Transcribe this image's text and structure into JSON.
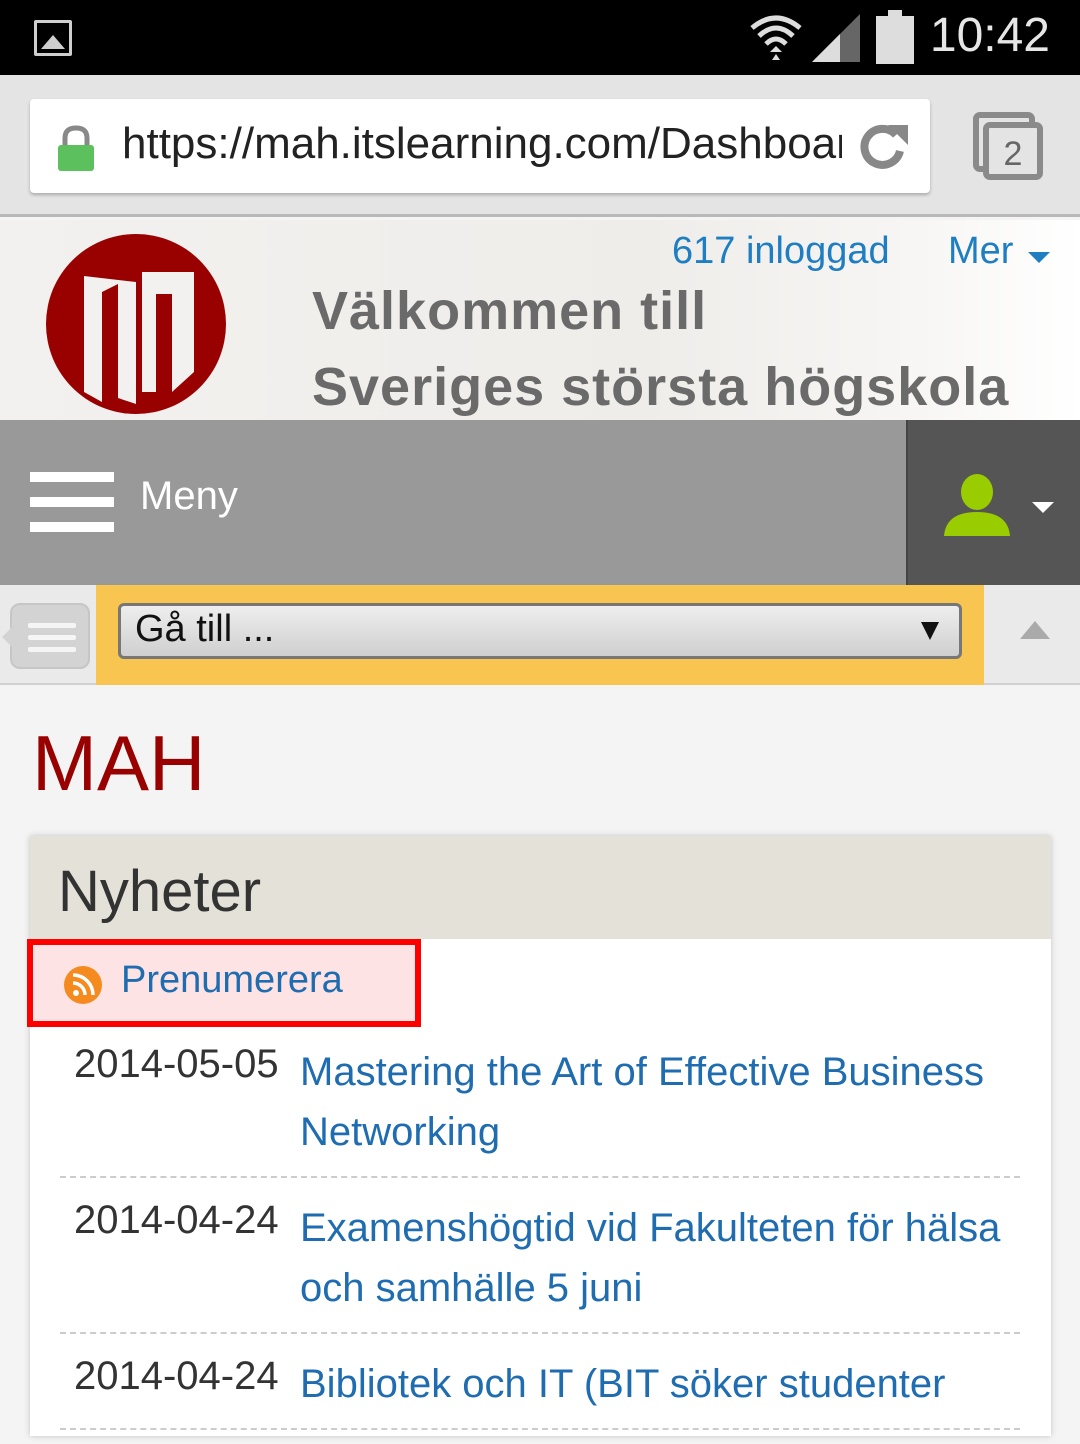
{
  "status_bar": {
    "time": "10:42",
    "icons": [
      "gallery-icon",
      "wifi-icon",
      "signal-icon",
      "battery-icon"
    ]
  },
  "browser": {
    "url": "https://mah.itslearning.com/Dashboard",
    "tab_count": "2",
    "icons": [
      "lock-icon",
      "reload-icon",
      "tabs-icon"
    ]
  },
  "header": {
    "welcome_line1": "Välkommen till",
    "welcome_line2": "Sveriges största högskola",
    "logged_in": "617 inloggad",
    "more": "Mer",
    "logo_color": "#990000"
  },
  "menu_bar": {
    "menu_label": "Meny",
    "user_icon_color": "#9acd00"
  },
  "goto": {
    "selected": "Gå till ...",
    "accent": "#f7c550"
  },
  "main": {
    "page_title": "MAH",
    "news": {
      "title": "Nyheter",
      "subscribe": "Prenumerera",
      "items": [
        {
          "date": "2014-05-05",
          "title": "Mastering the Art of Effective Business Networking"
        },
        {
          "date": "2014-04-24",
          "title": "Examenshögtid vid Fakulteten för hälsa och samhälle 5 juni"
        },
        {
          "date": "2014-04-24",
          "title": "Bibliotek och IT (BIT söker studenter"
        }
      ]
    }
  }
}
